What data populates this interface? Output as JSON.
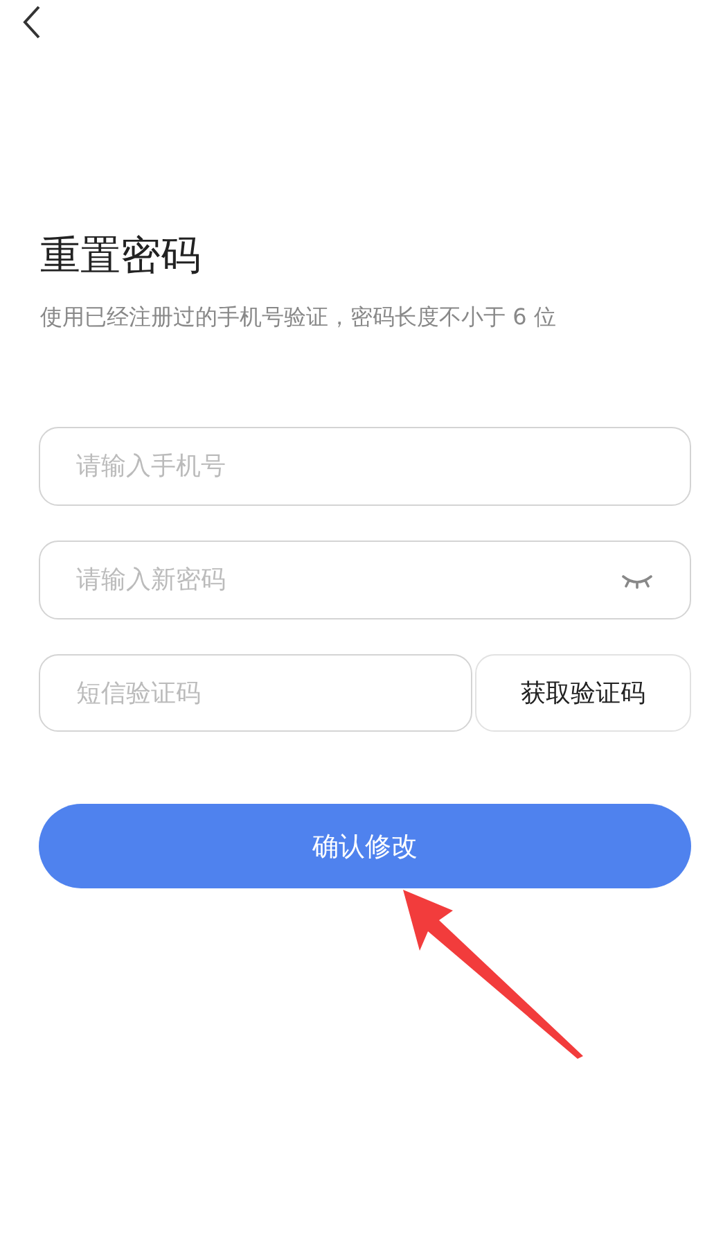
{
  "title": "重置密码",
  "subtitle": "使用已经注册过的手机号验证，密码长度不小于 6 位",
  "fields": [
    {
      "kind": "phone",
      "placeholder": "请输入手机号"
    },
    {
      "kind": "password",
      "placeholder": "请输入新密码",
      "password_visible": false
    },
    {
      "kind": "code",
      "placeholder": "短信验证码",
      "button": "获取验证码"
    }
  ],
  "submit": "确认修改"
}
